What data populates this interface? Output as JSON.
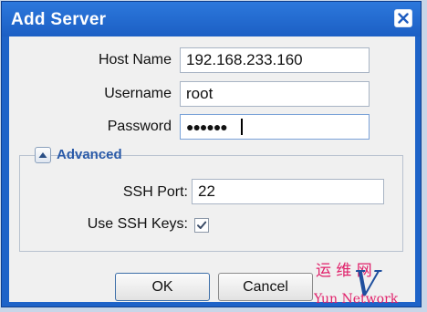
{
  "window": {
    "title": "Add Server"
  },
  "form": {
    "host_label": "Host Name",
    "host_value": "192.168.233.160",
    "username_label": "Username",
    "username_value": "root",
    "password_label": "Password",
    "password_value": "●●●●●●"
  },
  "advanced": {
    "legend": "Advanced",
    "ssh_port_label": "SSH Port:",
    "ssh_port_value": "22",
    "ssh_keys_label": "Use SSH Keys:",
    "ssh_keys_checked": true
  },
  "buttons": {
    "ok": "OK",
    "cancel": "Cancel"
  },
  "watermark": {
    "line1": "运 维 网",
    "line2": "Yun Network",
    "letter": "V"
  },
  "colors": {
    "titlebar": "#1e63c8",
    "body": "#f0f0f0",
    "accent": "#2a5aa8",
    "watermark": "#e0206a"
  }
}
